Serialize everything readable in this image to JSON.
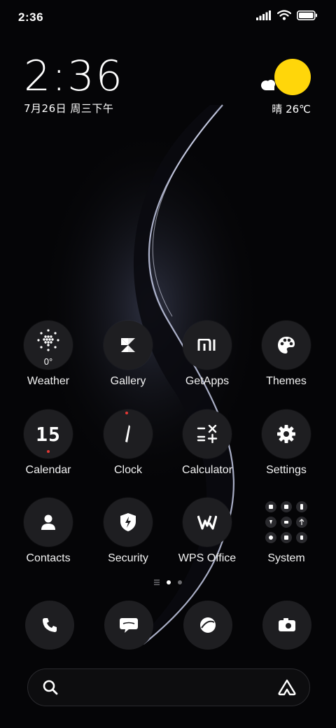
{
  "status_bar": {
    "time": "2:36"
  },
  "clock_widget": {
    "time": "2:36",
    "date": "7月26日 周三下午"
  },
  "weather_widget": {
    "text": "晴 26℃",
    "sun_color": "#ffd60a"
  },
  "apps": [
    {
      "label": "Weather",
      "icon": "weather-icon",
      "badge": "0°"
    },
    {
      "label": "Gallery",
      "icon": "gallery-icon"
    },
    {
      "label": "GetApps",
      "icon": "getapps-icon"
    },
    {
      "label": "Themes",
      "icon": "themes-icon"
    },
    {
      "label": "Calendar",
      "icon": "calendar-icon",
      "badge": "15"
    },
    {
      "label": "Clock",
      "icon": "clock-icon"
    },
    {
      "label": "Calculator",
      "icon": "calculator-icon"
    },
    {
      "label": "Settings",
      "icon": "settings-icon"
    },
    {
      "label": "Contacts",
      "icon": "contacts-icon"
    },
    {
      "label": "Security",
      "icon": "security-icon"
    },
    {
      "label": "WPS Office",
      "icon": "wps-office-icon"
    },
    {
      "label": "System",
      "icon": "system-folder-icon"
    }
  ],
  "dock": [
    {
      "icon": "phone-icon"
    },
    {
      "icon": "messages-icon"
    },
    {
      "icon": "browser-icon"
    },
    {
      "icon": "camera-icon"
    }
  ],
  "page_indicator": {
    "pages": 2,
    "active": 1
  },
  "colors": {
    "icon_bg": "#1e1e21",
    "background": "#050507",
    "accent_red": "#e53935"
  }
}
